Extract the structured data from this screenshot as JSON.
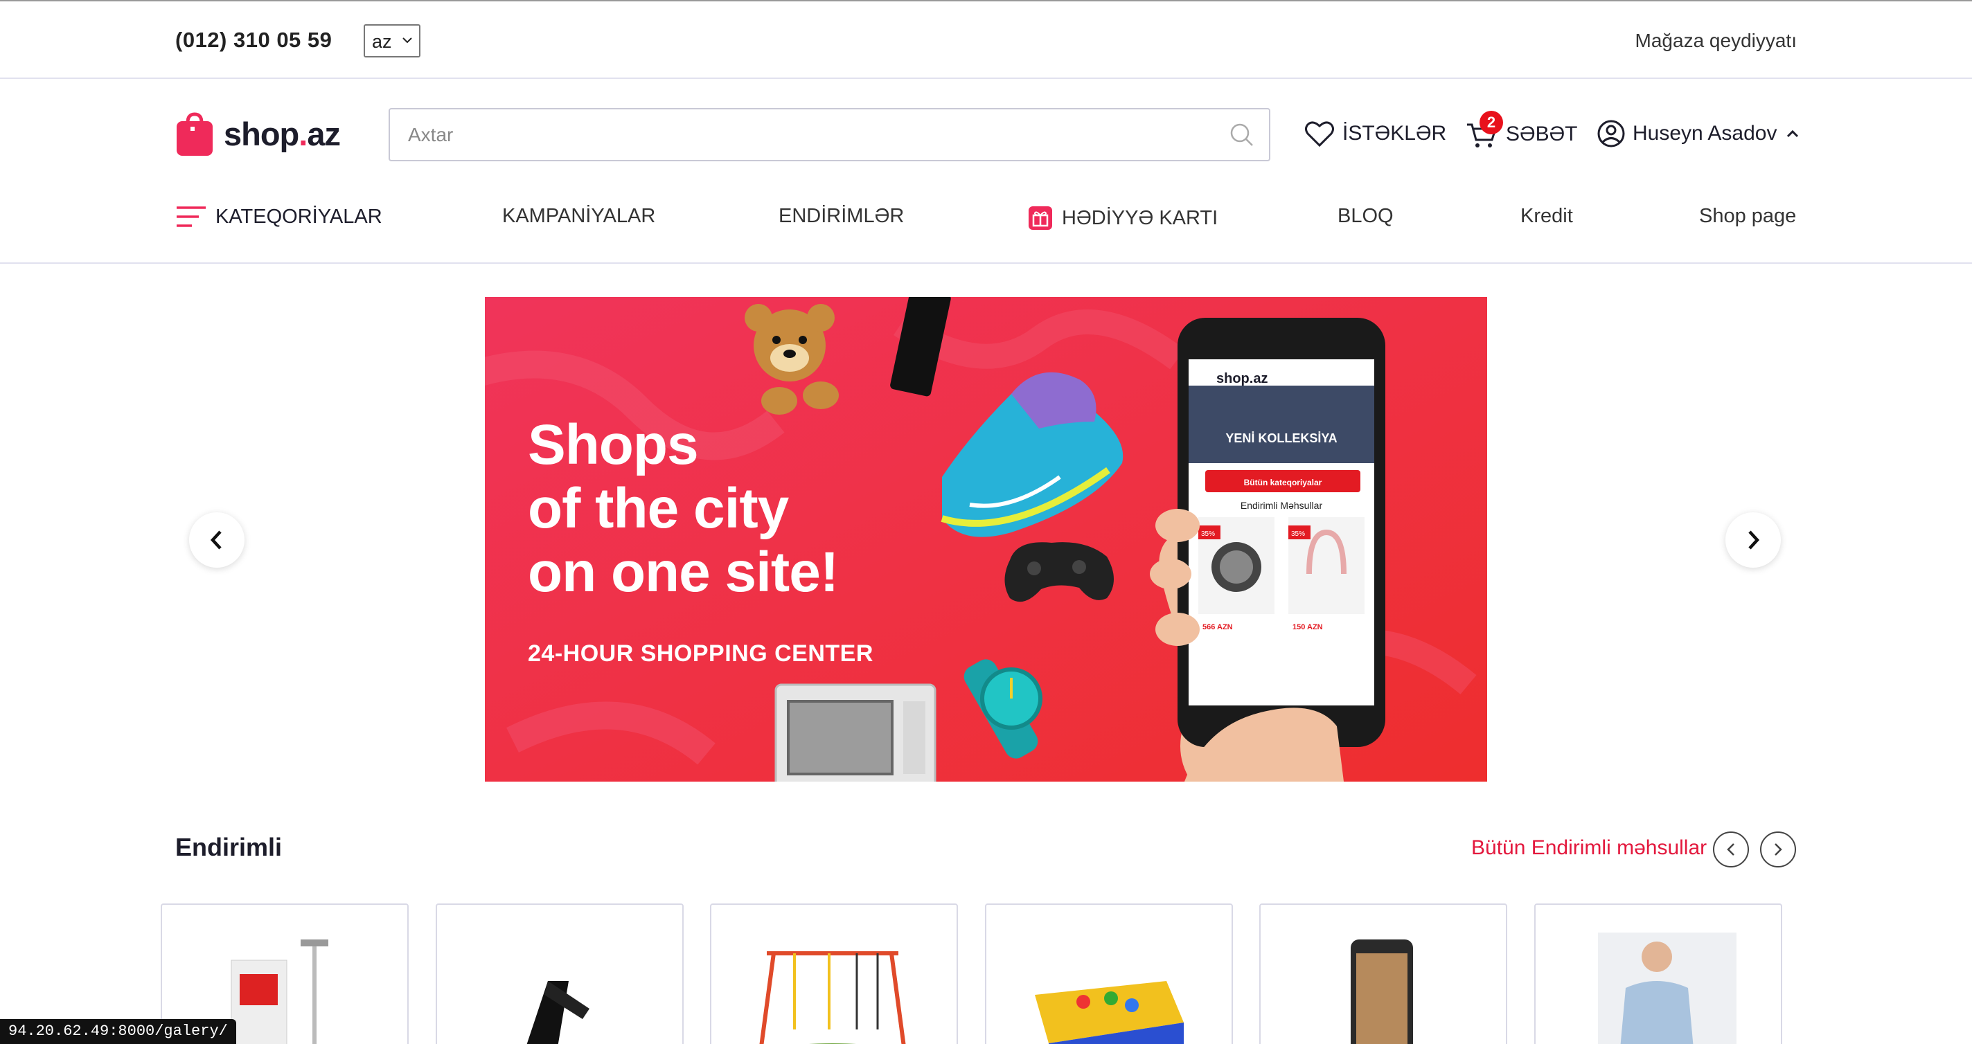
{
  "topbar": {
    "phone": "(012) 310 05 59",
    "language": "az",
    "store_register": "Mağaza qeydiyyatı"
  },
  "header": {
    "logo_text_main": "shop",
    "logo_text_dot": ".",
    "logo_text_tld": "az",
    "search_placeholder": "Axtar",
    "wishlist_label": "İSTƏKLƏR",
    "cart_label": "SƏBƏT",
    "cart_count": "2",
    "user_name": "Huseyn Asadov"
  },
  "nav": {
    "items": [
      {
        "label": "KATEQORİYALAR"
      },
      {
        "label": "KAMPANİYALAR"
      },
      {
        "label": "ENDİRİMLƏR"
      },
      {
        "label": "HƏDİYYƏ KARTI"
      },
      {
        "label": "BLOQ"
      },
      {
        "label": "Kredit"
      },
      {
        "label": "Shop page"
      }
    ]
  },
  "banner": {
    "title_line1": "Shops",
    "title_line2": "of the city",
    "title_line3": "on one site!",
    "subtitle": "24-HOUR SHOPPING CENTER",
    "phone_logo": "shop.az",
    "phone_banner": "YENİ KOLLEKSİYA",
    "phone_button": "Bütün kateqoriyalar",
    "phone_section": "Endirimli Məhsullar",
    "phone_discount": "35%",
    "phone_price1": "566 AZN",
    "phone_price2": "150 AZN"
  },
  "section": {
    "title": "Endirimli",
    "link": "Bütün Endirimli məhsullar"
  },
  "products": [
    {
      "name": "projector-screen"
    },
    {
      "name": "tablet-stand"
    },
    {
      "name": "swing-set"
    },
    {
      "name": "ball-pool"
    },
    {
      "name": "smartphone"
    },
    {
      "name": "shirt"
    }
  ],
  "status_bar": {
    "url": "94.20.62.49:8000/galery/"
  },
  "colors": {
    "brand": "#ef2a5a",
    "banner": "#ef3548",
    "link": "#e3183d"
  }
}
